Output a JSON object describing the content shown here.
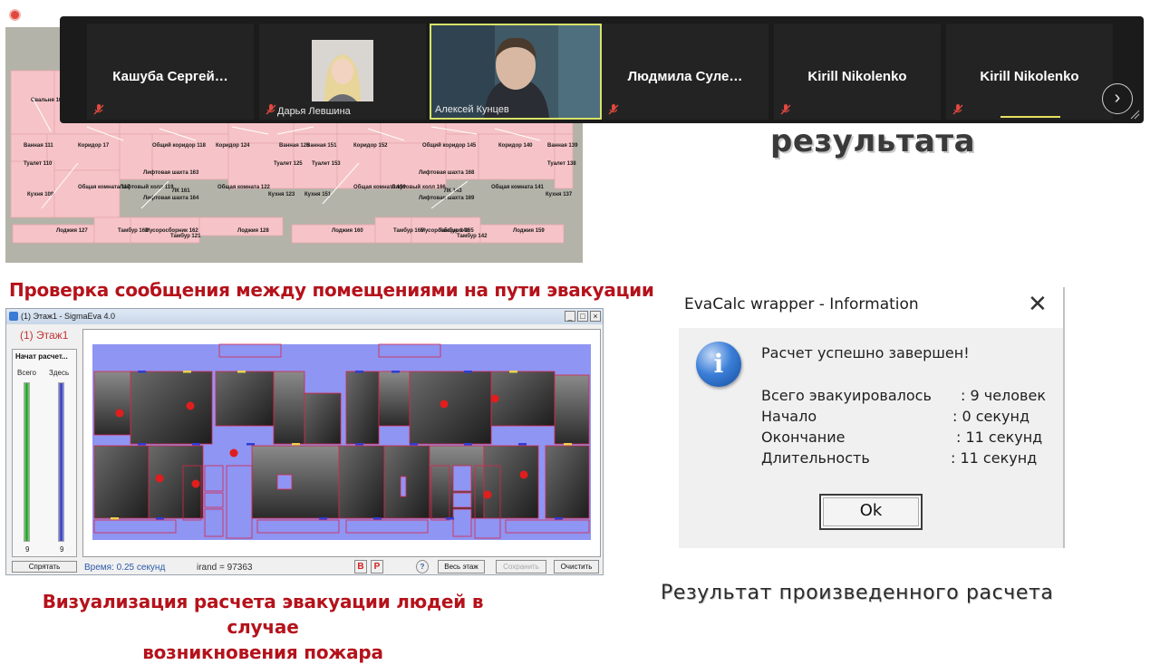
{
  "participants": [
    {
      "name": "Кашуба Сергей…",
      "show_big_name": true
    },
    {
      "name": "Дарья Левшина",
      "show_big_name": false
    },
    {
      "name": "Алексей Кунцев",
      "show_big_name": false
    },
    {
      "name": "Людмила Суле…",
      "show_big_name": true
    },
    {
      "name": "Kirill Nikolenko",
      "show_big_name": true
    },
    {
      "name": "Kirill Nikolenko",
      "show_big_name": true
    }
  ],
  "slide": {
    "result_word": "результата",
    "check_title": "Проверка сообщения между помещениями на пути эвакуации",
    "visual_caption_line1": "Визуализация расчета эвакуации людей в случае",
    "visual_caption_line2": "возникновения пожара",
    "result_caption": "Результат произведенного расчета"
  },
  "floorplan": {
    "labels": [
      "Свальня 10",
      "Ванная 111",
      "Коридор 17",
      "Общий коридор 118",
      "Коридор 124",
      "Ванная 126",
      "Ванная 151",
      "Коридор 152",
      "Общий коридор 145",
      "Коридор 140",
      "Ванная 139",
      "Туалет 110",
      "Туалет 125",
      "Туалет 153",
      "Туалет 138",
      "Лифтовая шахта 163",
      "Лифтовая шахта 168",
      "Кухня 109",
      "Общая комната 117",
      "Лифтовый холл 119",
      "ЛК 161",
      "Лифтовая шахта 164",
      "Общая комната 122",
      "Кухня 123",
      "Кухня 151",
      "Общая комната 150",
      "Лифтовый холл 166",
      "ЛК 143",
      "Лифтовая шахта 169",
      "Общая комната 141",
      "Кухня 137",
      "Лоджия 127",
      "Тамбур 162",
      "Мусоросборник 162",
      "Тамбур 121",
      "Лоджия 128",
      "Лоджия 160",
      "Тамбур 165",
      "Мусоросборник 165",
      "Тамбур 144",
      "Тамбур 142",
      "Лоджия 159"
    ]
  },
  "sigma": {
    "title": "(1) Этаж1 - SigmaEva 4.0",
    "floor_label": "(1) Этаж1",
    "start_label": "Начат расчет...",
    "total_label": "Всего",
    "here_label": "Здесь",
    "total_count": "9",
    "here_count": "9",
    "hide_button": "Спрятать",
    "time_text": "Время: 0.25 секунд",
    "irand_text": "irand = 97363",
    "btn_v": "В",
    "btn_r": "Р",
    "btn_whole_floor": "Весь этаж",
    "btn_save": "Сохранить",
    "btn_clear": "Очистить"
  },
  "dialog": {
    "title": "EvaCalc wrapper - Information",
    "close": "✕",
    "message": "Расчет успешно завершен!",
    "rows": [
      {
        "label": "Всего эвакуировалось",
        "value": ": 9 человек"
      },
      {
        "label": "Начало",
        "value": ": 0 секунд"
      },
      {
        "label": "Окончание",
        "value": ": 11 секунд"
      },
      {
        "label": "Длительность",
        "value": ": 11 секунд"
      }
    ],
    "ok": "Ok"
  },
  "colors": {
    "accent_red": "#b5121b",
    "zoom_bg": "#1b1b1b",
    "speaker_highlight": "#d8e26a",
    "plan_room": "#f6c4c8",
    "sim_room_blue": "#8f95f2"
  }
}
